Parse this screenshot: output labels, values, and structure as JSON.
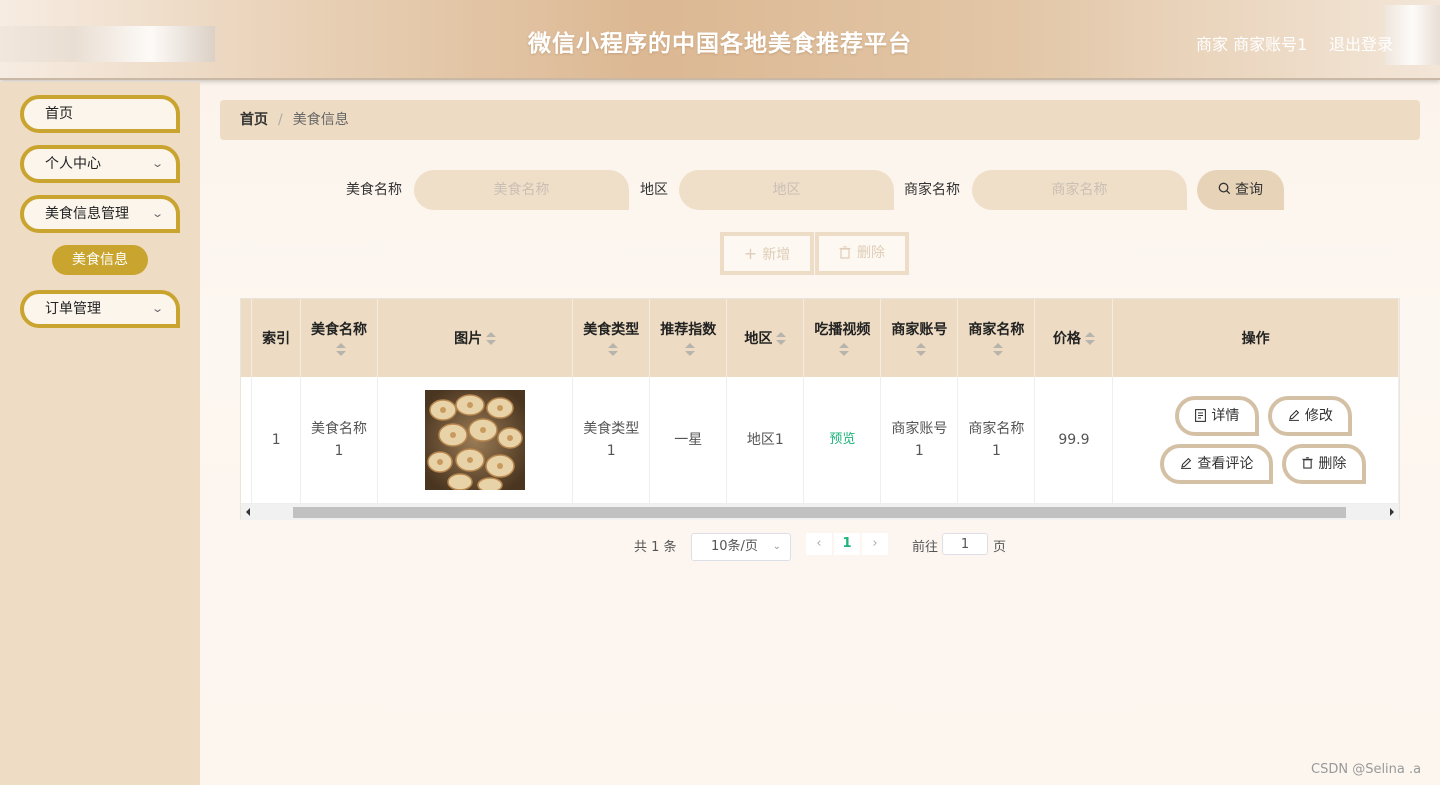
{
  "header": {
    "title": "微信小程序的中国各地美食推荐平台",
    "user": "商家 商家账号1",
    "logout": "退出登录"
  },
  "sidebar": {
    "items": [
      {
        "label": "首页"
      },
      {
        "label": "个人中心"
      },
      {
        "label": "美食信息管理"
      },
      {
        "label": "订单管理"
      }
    ],
    "active_sub": "美食信息"
  },
  "breadcrumb": {
    "home": "首页",
    "sep": "/",
    "current": "美食信息"
  },
  "search": {
    "name_label": "美食名称",
    "name_placeholder": "美食名称",
    "region_label": "地区",
    "region_placeholder": "地区",
    "merchant_label": "商家名称",
    "merchant_placeholder": "商家名称",
    "query_label": "查询"
  },
  "actions": {
    "add_label": "新增",
    "delete_label": "删除"
  },
  "table": {
    "columns": [
      "索引",
      "美食名称",
      "图片",
      "美食类型",
      "推荐指数",
      "地区",
      "吃播视频",
      "商家账号",
      "商家名称",
      "价格",
      "操作"
    ],
    "rows": [
      {
        "index": "1",
        "name_l1": "美食名称",
        "name_l2": "1",
        "type_l1": "美食类型",
        "type_l2": "1",
        "rating": "一星",
        "region": "地区1",
        "video": "预览",
        "account_l1": "商家账号",
        "account_l2": "1",
        "merchant_l1": "商家名称",
        "merchant_l2": "1",
        "price": "99.9"
      }
    ],
    "op_labels": {
      "detail": "详情",
      "edit": "修改",
      "comments": "查看评论",
      "delete": "删除"
    }
  },
  "pagination": {
    "total": "共 1 条",
    "page_size": "10条/页",
    "current": "1",
    "goto": "前往",
    "goto_value": "1",
    "page_suffix": "页"
  },
  "watermark": "CSDN @Selina .a",
  "colors": {
    "accent": "#c9a42f",
    "header_bg": "#dcb893",
    "sidebar_bg": "#efdcc4",
    "link": "#1db37a"
  }
}
